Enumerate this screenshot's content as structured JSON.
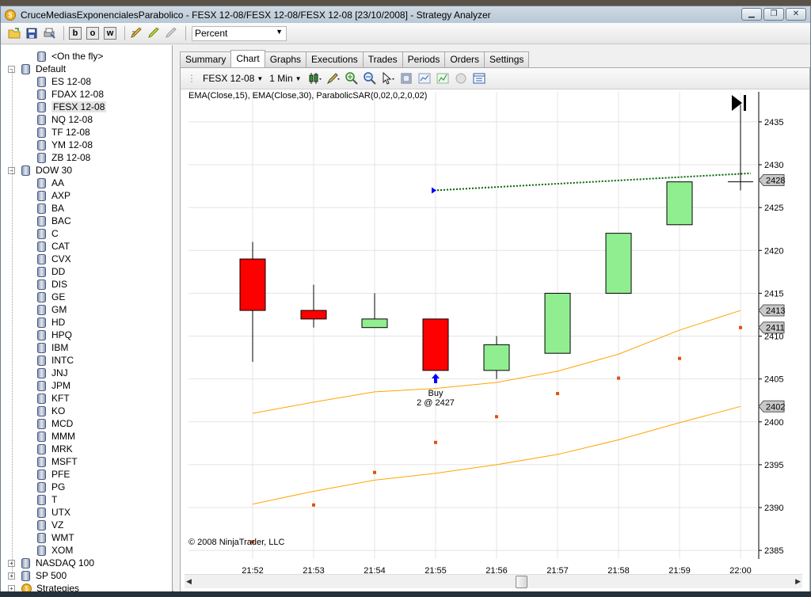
{
  "window": {
    "title": "CruceMediasExponencialesParabolico - FESX 12-08/FESX 12-08/FESX 12-08 [23/10/2008] - Strategy Analyzer",
    "app_icon": "$",
    "controls": [
      "minimize-icon",
      "maximize-icon",
      "close-icon"
    ]
  },
  "toolbar": {
    "icons": [
      "open-folder-icon",
      "save-icon",
      "print-icon",
      "bold-b-icon",
      "bold-o-icon",
      "bold-w-icon",
      "pencil-icon",
      "highlighter-icon",
      "eraser-icon"
    ],
    "letters": [
      "b",
      "o",
      "w"
    ],
    "template_value": "Percent"
  },
  "tree": {
    "items": [
      {
        "label": "<On the fly>",
        "level": 1,
        "icon": "database-icon",
        "expander": ""
      },
      {
        "label": "Default",
        "level": 0,
        "icon": "database-icon",
        "expander": "−"
      },
      {
        "label": "ES 12-08",
        "level": 1,
        "icon": "database-icon",
        "expander": ""
      },
      {
        "label": "FDAX 12-08",
        "level": 1,
        "icon": "database-icon",
        "expander": ""
      },
      {
        "label": "FESX 12-08",
        "level": 1,
        "icon": "database-icon",
        "expander": "",
        "selected": true
      },
      {
        "label": "NQ 12-08",
        "level": 1,
        "icon": "database-icon",
        "expander": ""
      },
      {
        "label": "TF 12-08",
        "level": 1,
        "icon": "database-icon",
        "expander": ""
      },
      {
        "label": "YM 12-08",
        "level": 1,
        "icon": "database-icon",
        "expander": ""
      },
      {
        "label": "ZB 12-08",
        "level": 1,
        "icon": "database-icon",
        "expander": ""
      },
      {
        "label": "DOW 30",
        "level": 0,
        "icon": "database-icon",
        "expander": "−"
      },
      {
        "label": "AA",
        "level": 1,
        "icon": "database-icon",
        "expander": ""
      },
      {
        "label": "AXP",
        "level": 1,
        "icon": "database-icon",
        "expander": ""
      },
      {
        "label": "BA",
        "level": 1,
        "icon": "database-icon",
        "expander": ""
      },
      {
        "label": "BAC",
        "level": 1,
        "icon": "database-icon",
        "expander": ""
      },
      {
        "label": "C",
        "level": 1,
        "icon": "database-icon",
        "expander": ""
      },
      {
        "label": "CAT",
        "level": 1,
        "icon": "database-icon",
        "expander": ""
      },
      {
        "label": "CVX",
        "level": 1,
        "icon": "database-icon",
        "expander": ""
      },
      {
        "label": "DD",
        "level": 1,
        "icon": "database-icon",
        "expander": ""
      },
      {
        "label": "DIS",
        "level": 1,
        "icon": "database-icon",
        "expander": ""
      },
      {
        "label": "GE",
        "level": 1,
        "icon": "database-icon",
        "expander": ""
      },
      {
        "label": "GM",
        "level": 1,
        "icon": "database-icon",
        "expander": ""
      },
      {
        "label": "HD",
        "level": 1,
        "icon": "database-icon",
        "expander": ""
      },
      {
        "label": "HPQ",
        "level": 1,
        "icon": "database-icon",
        "expander": ""
      },
      {
        "label": "IBM",
        "level": 1,
        "icon": "database-icon",
        "expander": ""
      },
      {
        "label": "INTC",
        "level": 1,
        "icon": "database-icon",
        "expander": ""
      },
      {
        "label": "JNJ",
        "level": 1,
        "icon": "database-icon",
        "expander": ""
      },
      {
        "label": "JPM",
        "level": 1,
        "icon": "database-icon",
        "expander": ""
      },
      {
        "label": "KFT",
        "level": 1,
        "icon": "database-icon",
        "expander": ""
      },
      {
        "label": "KO",
        "level": 1,
        "icon": "database-icon",
        "expander": ""
      },
      {
        "label": "MCD",
        "level": 1,
        "icon": "database-icon",
        "expander": ""
      },
      {
        "label": "MMM",
        "level": 1,
        "icon": "database-icon",
        "expander": ""
      },
      {
        "label": "MRK",
        "level": 1,
        "icon": "database-icon",
        "expander": ""
      },
      {
        "label": "MSFT",
        "level": 1,
        "icon": "database-icon",
        "expander": ""
      },
      {
        "label": "PFE",
        "level": 1,
        "icon": "database-icon",
        "expander": ""
      },
      {
        "label": "PG",
        "level": 1,
        "icon": "database-icon",
        "expander": ""
      },
      {
        "label": "T",
        "level": 1,
        "icon": "database-icon",
        "expander": ""
      },
      {
        "label": "UTX",
        "level": 1,
        "icon": "database-icon",
        "expander": ""
      },
      {
        "label": "VZ",
        "level": 1,
        "icon": "database-icon",
        "expander": ""
      },
      {
        "label": "WMT",
        "level": 1,
        "icon": "database-icon",
        "expander": ""
      },
      {
        "label": "XOM",
        "level": 1,
        "icon": "database-icon",
        "expander": ""
      },
      {
        "label": "NASDAQ 100",
        "level": 0,
        "icon": "database-icon",
        "expander": "+"
      },
      {
        "label": "SP 500",
        "level": 0,
        "icon": "database-icon",
        "expander": "+"
      },
      {
        "label": "Strategies",
        "level": 0,
        "icon": "strategy-icon",
        "expander": "+"
      }
    ]
  },
  "tabs": [
    {
      "label": "Summary",
      "active": false
    },
    {
      "label": "Chart",
      "active": true
    },
    {
      "label": "Graphs",
      "active": false
    },
    {
      "label": "Executions",
      "active": false
    },
    {
      "label": "Trades",
      "active": false
    },
    {
      "label": "Periods",
      "active": false
    },
    {
      "label": "Orders",
      "active": false
    },
    {
      "label": "Settings",
      "active": false
    }
  ],
  "chart_toolbar": {
    "instrument": "FESX 12-08",
    "interval": "1 Min",
    "icons": [
      "candlestick-style-icon",
      "drawing-pen-icon",
      "zoom-in-icon",
      "zoom-out-icon",
      "cursor-icon",
      "snapshot-icon",
      "indicators-icon",
      "strategies-icon",
      "circle-icon",
      "data-box-icon"
    ]
  },
  "chart_data": {
    "type": "candlestick",
    "indicator_label": "EMA(Close,15), EMA(Close,30), ParabolicSAR(0,02,0,2,0,02)",
    "copyright": "© 2008 NinjaTrader, LLC",
    "x": [
      "21:52",
      "21:53",
      "21:54",
      "21:55",
      "21:56",
      "21:57",
      "21:58",
      "21:59",
      "22:00"
    ],
    "candles": [
      {
        "open": 2419,
        "high": 2421,
        "low": 2407,
        "close": 2413
      },
      {
        "open": 2413,
        "high": 2416,
        "low": 2411,
        "close": 2412
      },
      {
        "open": 2411,
        "high": 2415,
        "low": 2411,
        "close": 2412
      },
      {
        "open": 2412,
        "high": 2412,
        "low": 2406,
        "close": 2406
      },
      {
        "open": 2406,
        "high": 2410,
        "low": 2405,
        "close": 2409
      },
      {
        "open": 2408,
        "high": 2415,
        "low": 2408,
        "close": 2415
      },
      {
        "open": 2415,
        "high": 2422,
        "low": 2415,
        "close": 2422
      },
      {
        "open": 2423,
        "high": 2428,
        "low": 2423,
        "close": 2428
      },
      {
        "open": 2428,
        "high": 2437,
        "low": 2427,
        "close": 2428
      }
    ],
    "ema15": [
      2401,
      2402.3,
      2403.5,
      2403.9,
      2404.6,
      2405.9,
      2407.9,
      2410.7,
      2413
    ],
    "ema30": [
      2390.4,
      2391.9,
      2393.2,
      2394,
      2395,
      2396.2,
      2397.9,
      2399.9,
      2401.8
    ],
    "parabolic_sar": [
      2386,
      2390.3,
      2394.1,
      2397.6,
      2400.6,
      2403.3,
      2405.1,
      2407.4,
      2411
    ],
    "y_ticks": [
      2385,
      2390,
      2395,
      2400,
      2405,
      2410,
      2415,
      2420,
      2425,
      2430,
      2435
    ],
    "ylim": [
      2384,
      2438.5
    ],
    "price_markers": [
      {
        "label": "2428",
        "value": 2428.2,
        "style": "gray"
      },
      {
        "label": "2413",
        "value": 2413,
        "style": "gray"
      },
      {
        "label": "2411",
        "value": 2411,
        "style": "gray"
      },
      {
        "label": "2402",
        "value": 2401.8,
        "style": "gray"
      }
    ],
    "trade": {
      "signal": "Buy",
      "text": "2 @ 2427",
      "entry_bar": 3,
      "entry_price": 2427,
      "line_end_price": 2429
    },
    "colors": {
      "up": "#90ee90",
      "down": "#ff0000",
      "ema": "#ffa500",
      "sar": "#e05010",
      "trade_line": "#006400",
      "buy_arrow": "#0000ff",
      "grid": "#e4e4e4"
    },
    "grid": true
  }
}
